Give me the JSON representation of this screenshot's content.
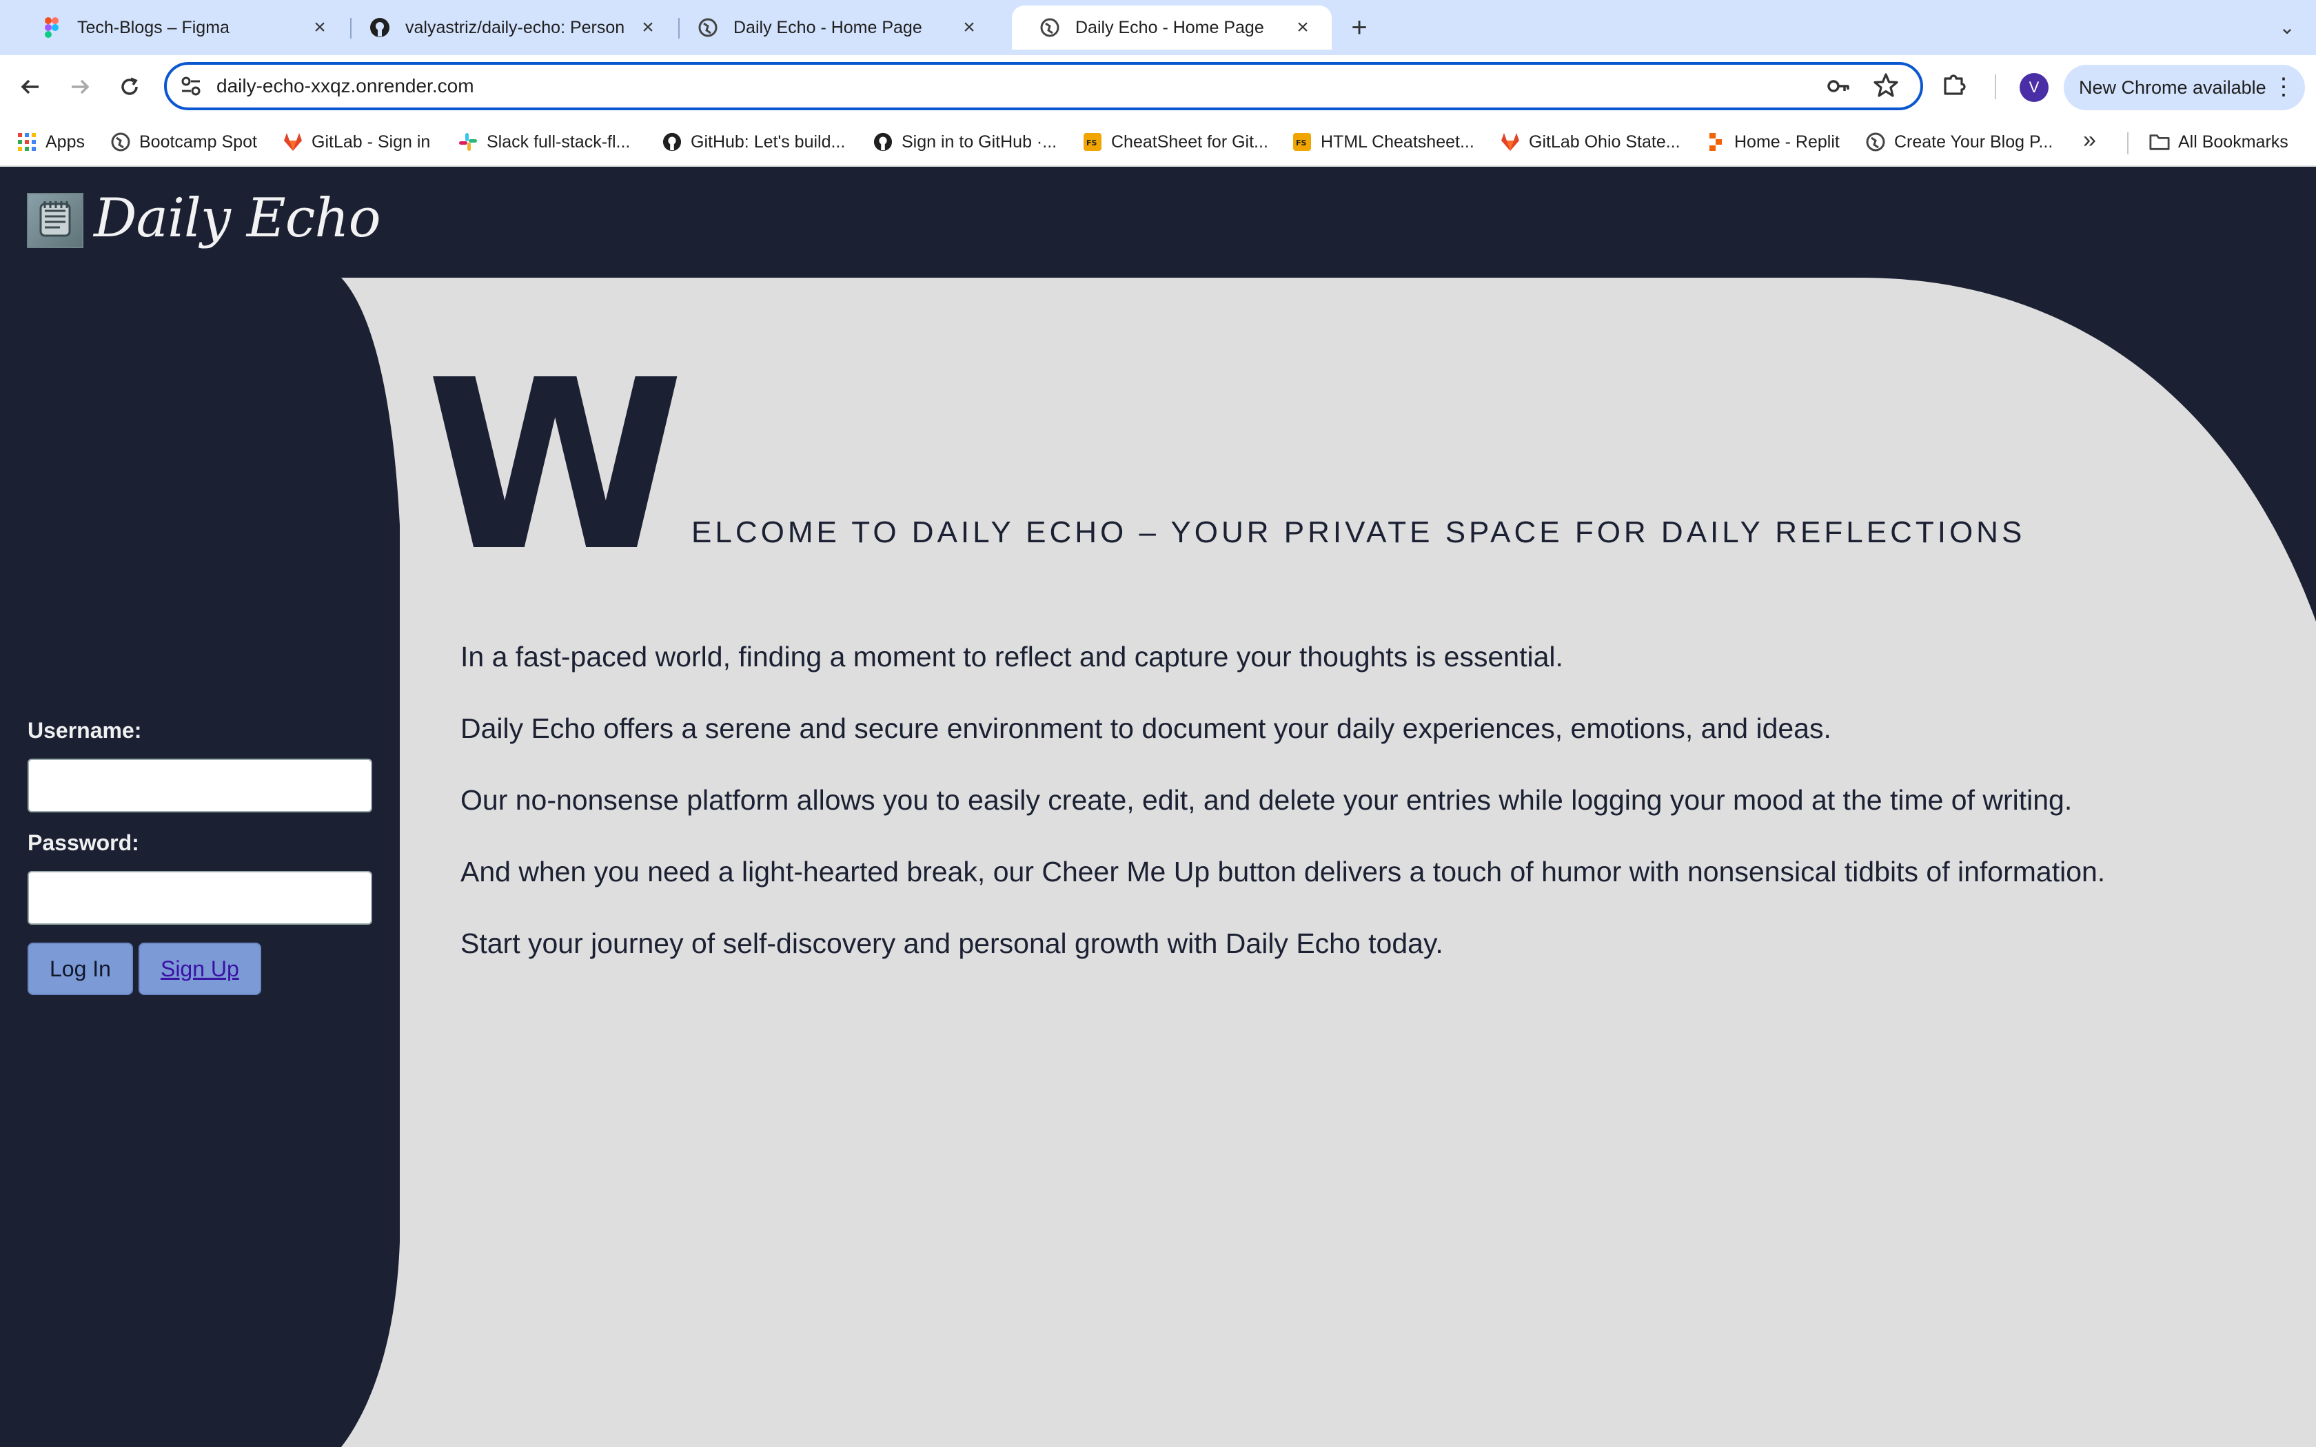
{
  "browser": {
    "tabs": [
      {
        "title": "Tech-Blogs – Figma",
        "icon": "figma-icon"
      },
      {
        "title": "valyastriz/daily-echo: Person",
        "icon": "github-icon"
      },
      {
        "title": "Daily Echo - Home Page",
        "icon": "globe-icon"
      },
      {
        "title": "Daily Echo - Home Page",
        "icon": "globe-icon",
        "active": true
      }
    ],
    "address": "daily-echo-xxqz.onrender.com",
    "avatar_letter": "V",
    "update_label": "New Chrome available",
    "bookmarks": [
      {
        "label": "Apps",
        "icon": "apps-grid-icon"
      },
      {
        "label": "Bootcamp Spot",
        "icon": "globe-icon"
      },
      {
        "label": "GitLab - Sign in",
        "icon": "gitlab-icon"
      },
      {
        "label": "Slack full-stack-fl...",
        "icon": "slack-icon"
      },
      {
        "label": "GitHub: Let's build...",
        "icon": "github-icon"
      },
      {
        "label": "Sign in to GitHub ·...",
        "icon": "github-icon"
      },
      {
        "label": "CheatSheet for Git...",
        "icon": "fs-icon"
      },
      {
        "label": "HTML Cheatsheet...",
        "icon": "fs-icon"
      },
      {
        "label": "GitLab Ohio State...",
        "icon": "gitlab-icon"
      },
      {
        "label": "Home - Replit",
        "icon": "replit-icon"
      },
      {
        "label": "Create Your Blog P...",
        "icon": "globe-icon"
      }
    ],
    "all_bookmarks": "All Bookmarks"
  },
  "site": {
    "name": "Daily Echo",
    "login": {
      "username_label": "Username:",
      "password_label": "Password:",
      "login_button": "Log In",
      "signup_button": "Sign Up"
    },
    "headline_cap": "W",
    "headline_rest": "ELCOME TO DAILY ECHO – YOUR PRIVATE SPACE FOR DAILY REFLECTIONS",
    "paragraphs": [
      "In a fast-paced world, finding a moment to reflect and capture your thoughts is essential.",
      "Daily Echo offers a serene and secure environment to document your daily experiences, emotions, and ideas.",
      "Our no-nonsense platform allows you to easily create, edit, and delete your entries while logging your mood at the time of writing.",
      "And when you need a light-hearted break, our Cheer Me Up button delivers a touch of humor with nonsensical tidbits of information.",
      "Start your journey of self-discovery and personal growth with Daily Echo today."
    ]
  },
  "colors": {
    "page_bg": "#1b2033",
    "card_bg": "#dedede",
    "button_bg": "#7c9ad6",
    "tabstrip_bg": "#d3e3fd",
    "focus_ring": "#0b57d0"
  }
}
